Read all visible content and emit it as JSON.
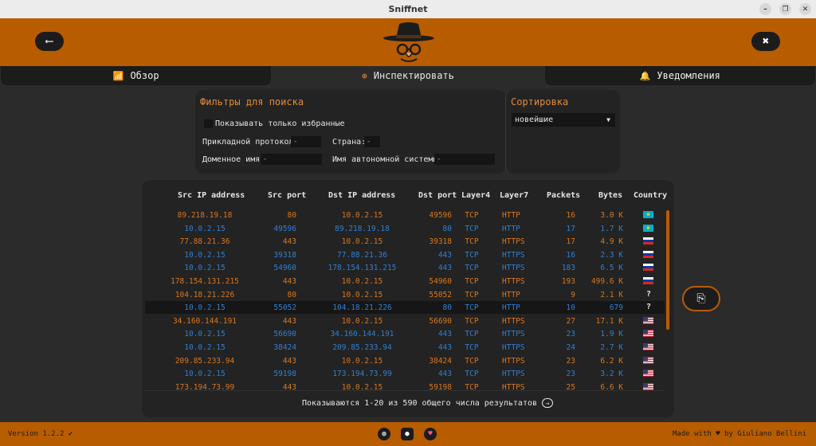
{
  "window": {
    "title": "Sniffnet"
  },
  "tabs": [
    {
      "label": "Обзор",
      "icon": "chart-icon"
    },
    {
      "label": "Инспектировать",
      "icon": "search-icon"
    },
    {
      "label": "Уведомления",
      "icon": "bell-icon"
    }
  ],
  "filters": {
    "title": "Фильтры для поиска",
    "favorites_label": "Показывать только избранные",
    "app_protocol_label": "Прикладной протокол:",
    "app_protocol_value": "-",
    "country_label": "Страна:",
    "country_value": "-",
    "domain_label": "Доменное имя:",
    "domain_value": "-",
    "as_label": "Имя автономной системы:",
    "as_value": "-"
  },
  "sort": {
    "title": "Сортировка",
    "selected": "новейшие"
  },
  "table": {
    "headers": [
      "Src IP address",
      "Src port",
      "Dst IP address",
      "Dst port",
      "Layer4",
      "Layer7",
      "Packets",
      "Bytes",
      "Country"
    ],
    "rows": [
      {
        "src": "89.218.19.18",
        "sport": "80",
        "dst": "10.0.2.15",
        "dport": "49596",
        "l4": "TCP",
        "l7": "HTTP",
        "pkts": "16",
        "bytes": "3.0 K",
        "country": "KZ",
        "dir": "in"
      },
      {
        "src": "10.0.2.15",
        "sport": "49596",
        "dst": "89.218.19.18",
        "dport": "80",
        "l4": "TCP",
        "l7": "HTTP",
        "pkts": "17",
        "bytes": "1.7 K",
        "country": "KZ",
        "dir": "out"
      },
      {
        "src": "77.88.21.36",
        "sport": "443",
        "dst": "10.0.2.15",
        "dport": "39318",
        "l4": "TCP",
        "l7": "HTTPS",
        "pkts": "17",
        "bytes": "4.9 K",
        "country": "RU",
        "dir": "in"
      },
      {
        "src": "10.0.2.15",
        "sport": "39318",
        "dst": "77.88.21.36",
        "dport": "443",
        "l4": "TCP",
        "l7": "HTTPS",
        "pkts": "16",
        "bytes": "2.3 K",
        "country": "RU",
        "dir": "out"
      },
      {
        "src": "10.0.2.15",
        "sport": "54960",
        "dst": "178.154.131.215",
        "dport": "443",
        "l4": "TCP",
        "l7": "HTTPS",
        "pkts": "183",
        "bytes": "6.5 K",
        "country": "RU",
        "dir": "out"
      },
      {
        "src": "178.154.131.215",
        "sport": "443",
        "dst": "10.0.2.15",
        "dport": "54960",
        "l4": "TCP",
        "l7": "HTTPS",
        "pkts": "193",
        "bytes": "499.6 K",
        "country": "RU",
        "dir": "in"
      },
      {
        "src": "104.18.21.226",
        "sport": "80",
        "dst": "10.0.2.15",
        "dport": "55052",
        "l4": "TCP",
        "l7": "HTTP",
        "pkts": "9",
        "bytes": "2.1 K",
        "country": "?",
        "dir": "in"
      },
      {
        "src": "10.0.2.15",
        "sport": "55052",
        "dst": "104.18.21.226",
        "dport": "80",
        "l4": "TCP",
        "l7": "HTTP",
        "pkts": "10",
        "bytes": "679",
        "country": "?",
        "dir": "out"
      },
      {
        "src": "34.160.144.191",
        "sport": "443",
        "dst": "10.0.2.15",
        "dport": "56690",
        "l4": "TCP",
        "l7": "HTTPS",
        "pkts": "27",
        "bytes": "17.1 K",
        "country": "US",
        "dir": "in"
      },
      {
        "src": "10.0.2.15",
        "sport": "56690",
        "dst": "34.160.144.191",
        "dport": "443",
        "l4": "TCP",
        "l7": "HTTPS",
        "pkts": "23",
        "bytes": "1.9 K",
        "country": "US",
        "dir": "out"
      },
      {
        "src": "10.0.2.15",
        "sport": "38424",
        "dst": "209.85.233.94",
        "dport": "443",
        "l4": "TCP",
        "l7": "HTTPS",
        "pkts": "24",
        "bytes": "2.7 K",
        "country": "US",
        "dir": "out"
      },
      {
        "src": "209.85.233.94",
        "sport": "443",
        "dst": "10.0.2.15",
        "dport": "38424",
        "l4": "TCP",
        "l7": "HTTPS",
        "pkts": "23",
        "bytes": "6.2 K",
        "country": "US",
        "dir": "in"
      },
      {
        "src": "10.0.2.15",
        "sport": "59198",
        "dst": "173.194.73.99",
        "dport": "443",
        "l4": "TCP",
        "l7": "HTTPS",
        "pkts": "23",
        "bytes": "3.2 K",
        "country": "US",
        "dir": "out"
      },
      {
        "src": "173.194.73.99",
        "sport": "443",
        "dst": "10.0.2.15",
        "dport": "59198",
        "l4": "TCP",
        "l7": "HTTPS",
        "pkts": "25",
        "bytes": "6.6 K",
        "country": "US",
        "dir": "in"
      }
    ],
    "results_text": "Показываются 1-20 из 590 общего числа результатов"
  },
  "footer": {
    "version": "Version 1.2.2 ✔",
    "made_with": "Made with ♥ by Giuliano Bellini"
  },
  "colors": {
    "accent": "#b85c00",
    "incoming": "#d9761f",
    "outgoing": "#2f7fd1",
    "background": "#2b2b2b"
  }
}
